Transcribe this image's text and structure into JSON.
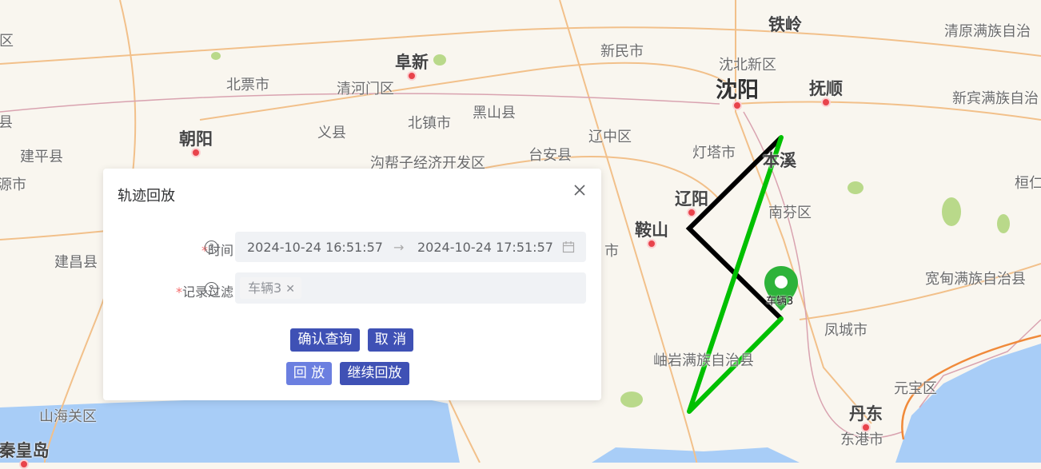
{
  "map": {
    "labels": [
      "铁岭",
      "清原满族自治",
      "阜新",
      "新民市",
      "沈北新区",
      "沈阳",
      "抚顺",
      "新宾满族自治",
      "北票市",
      "清河门区",
      "黑山县",
      "北镇市",
      "义县",
      "辽中区",
      "朝阳",
      "建平县",
      "灯塔市",
      "本溪",
      "台安县",
      "沟帮子经济开发区",
      "辽阳",
      "南芬区",
      "桓仁",
      "鞍山",
      "宽甸满族自治县",
      "凤城市",
      "岫岩满族自治县",
      "元宝区",
      "丹东",
      "东港市",
      "山海关区",
      "秦皇岛",
      "建昌县",
      "县",
      "区",
      "源市",
      "市"
    ],
    "vehicle_marker_label": "车辆3",
    "track_colors": {
      "planned": "#000000",
      "actual": "#00c000"
    },
    "marker_color": "#2db33a"
  },
  "dialog": {
    "title": "轨迹回放",
    "time_label": "时间",
    "filter_label": "记录过滤",
    "required_mark": "*",
    "help_glyph": "?",
    "start_time": "2024-10-24 16:51:57",
    "range_separator": "→",
    "end_time": "2024-10-24 17:51:57",
    "filter_tags": [
      "车辆3"
    ],
    "buttons": {
      "confirm": "确认查询",
      "cancel": "取 消",
      "replay": "回 放",
      "continue": "继续回放"
    },
    "accent": "#3f51b5"
  }
}
